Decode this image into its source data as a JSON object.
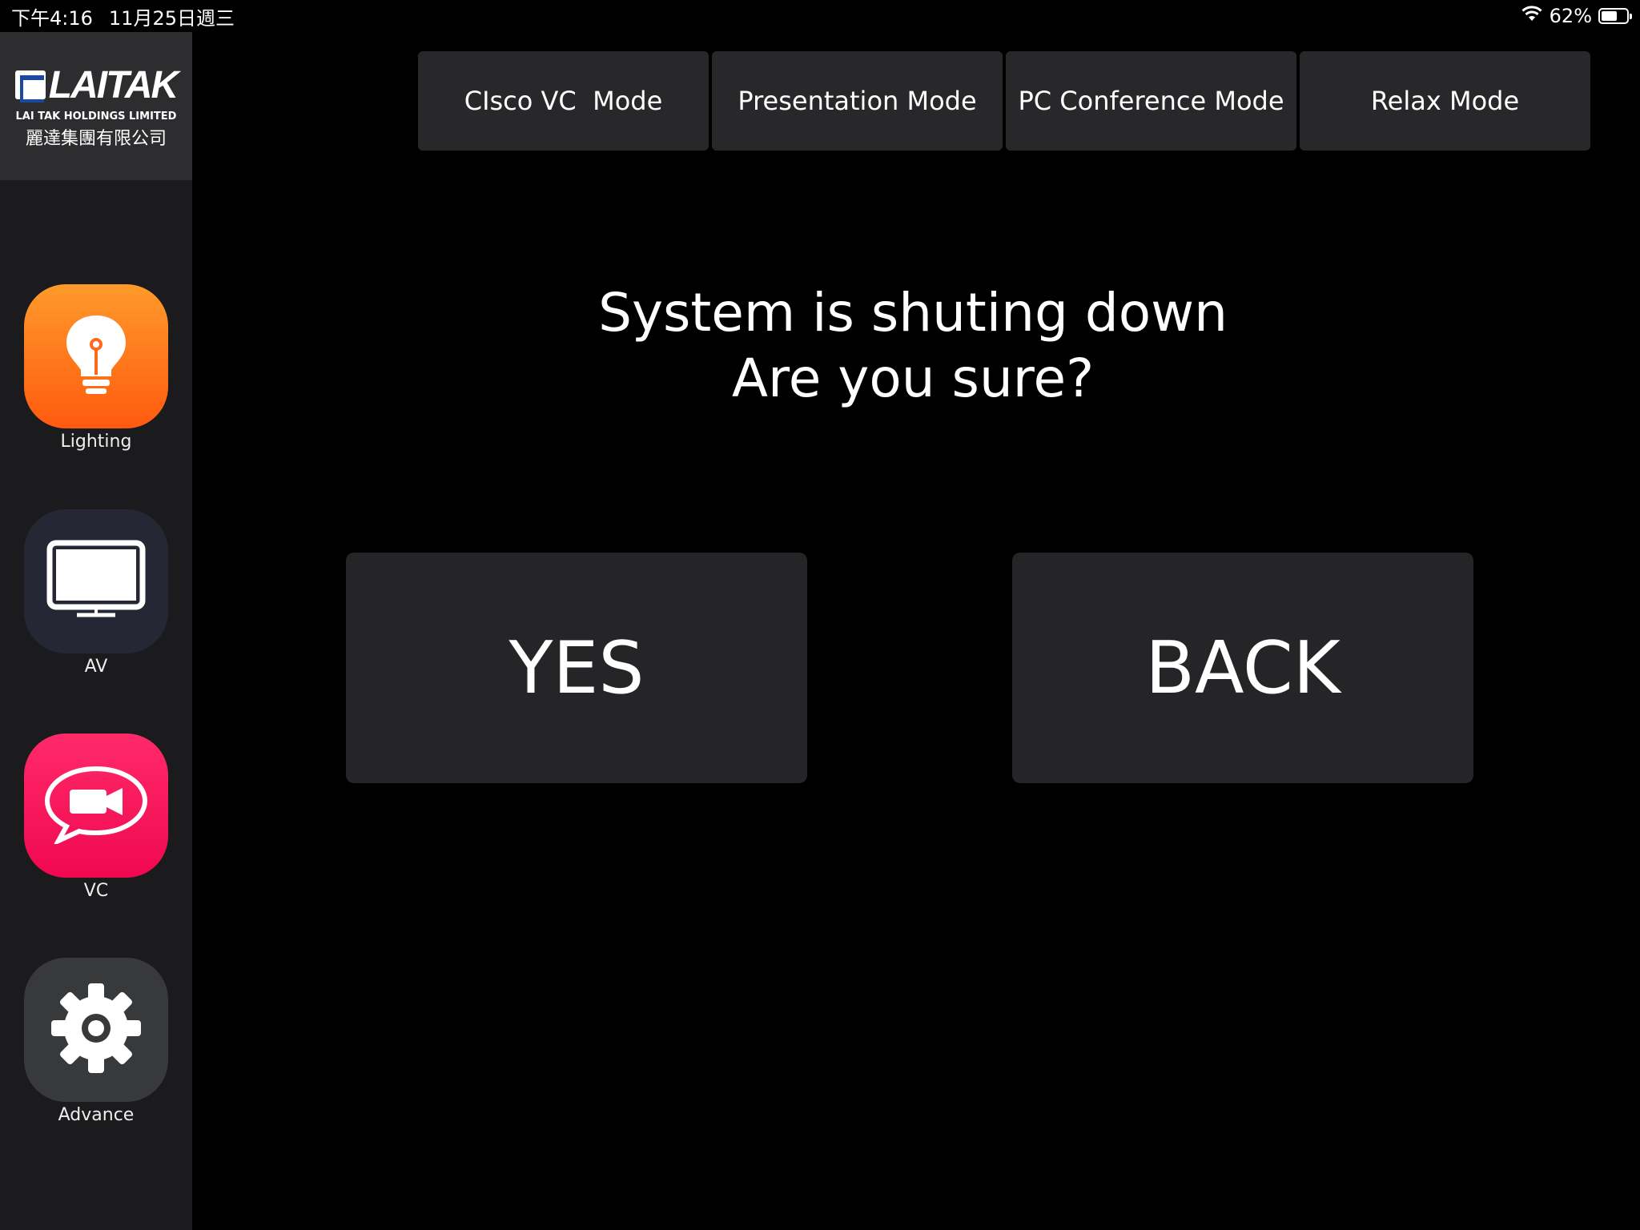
{
  "status_bar": {
    "time": "下午4:16",
    "date": "11月25日週三",
    "battery_percent": "62%",
    "battery_level": 0.62
  },
  "logo": {
    "brand": "LAITAK",
    "subtitle_en": "LAI TAK HOLDINGS LIMITED",
    "subtitle_zh": "麗達集團有限公司"
  },
  "sidebar": {
    "items": [
      {
        "label": "Lighting",
        "icon": "lightbulb-icon",
        "color": "#ff6a1a"
      },
      {
        "label": "AV",
        "icon": "monitor-icon",
        "color": "#2a2b3a"
      },
      {
        "label": "VC",
        "icon": "video-chat-icon",
        "color": "#f5105a"
      },
      {
        "label": "Advance",
        "icon": "gear-icon",
        "color": "#38393b"
      }
    ]
  },
  "modes": [
    {
      "label": "CIsco VC  Mode"
    },
    {
      "label": "Presentation Mode"
    },
    {
      "label": "PC Conference Mode"
    },
    {
      "label": "Relax Mode"
    }
  ],
  "dialog": {
    "line1": "System is shuting down",
    "line2": "Are you sure?",
    "yes_label": "YES",
    "back_label": "BACK"
  }
}
